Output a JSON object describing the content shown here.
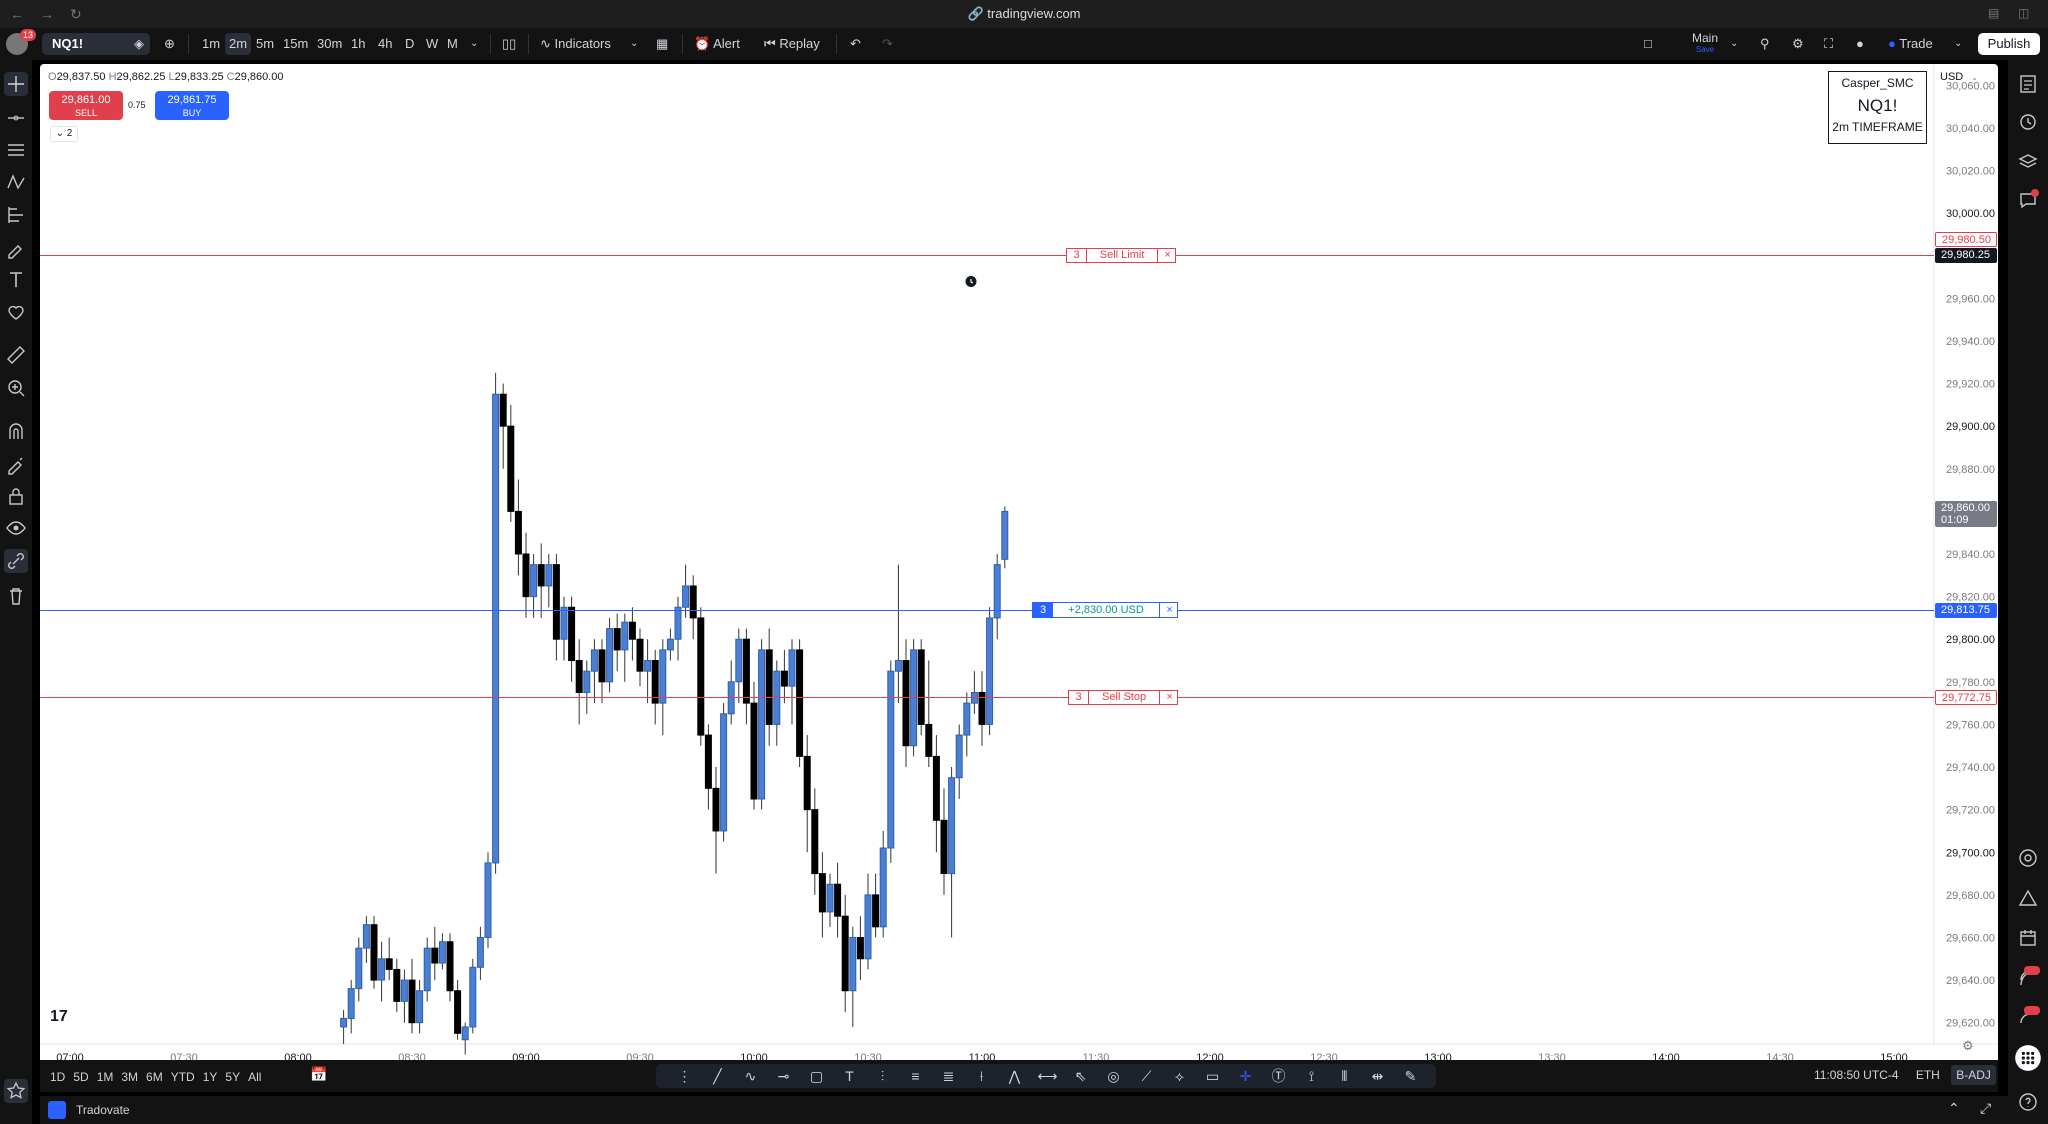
{
  "browser": {
    "url": "tradingview.com"
  },
  "header": {
    "notification_count": "13",
    "symbol": "NQ1!",
    "intervals": [
      "1m",
      "2m",
      "5m",
      "15m",
      "30m",
      "1h",
      "4h",
      "D",
      "W",
      "M"
    ],
    "active_interval": "2m",
    "indicators_label": "Indicators",
    "alert_label": "Alert",
    "replay_label": "Replay",
    "layout_name": "Main",
    "layout_sub": "Save",
    "trade_label": "Trade",
    "publish_label": "Publish"
  },
  "chart": {
    "ohlc": {
      "o_label": "O",
      "o": "29,837.50",
      "h_label": "H",
      "h": "29,862.25",
      "l_label": "L",
      "l": "29,833.25",
      "c_label": "C",
      "c": "29,860.00"
    },
    "sell_price": "29,861.00",
    "sell_label": "SELL",
    "buy_price": "29,861.75",
    "buy_label": "BUY",
    "spread": "0.75",
    "collapse_count": "2",
    "infobox": {
      "line1": "Casper_SMC",
      "line2": "NQ1!",
      "line3": "2m TIMEFRAME"
    },
    "currency": "USD",
    "y_ticks": [
      "30,060.00",
      "30,040.00",
      "30,020.00",
      "30,000.00",
      "29,980.00",
      "29,960.00",
      "29,940.00",
      "29,920.00",
      "29,900.00",
      "29,880.00",
      "29,860.00",
      "29,840.00",
      "29,820.00",
      "29,800.00",
      "29,780.00",
      "29,760.00",
      "29,740.00",
      "29,720.00",
      "29,700.00",
      "29,680.00",
      "29,660.00",
      "29,640.00",
      "29,620.00"
    ],
    "y_tick_values": [
      30060,
      30040,
      30020,
      30000,
      29980,
      29960,
      29940,
      29920,
      29900,
      29880,
      29860,
      29840,
      29820,
      29800,
      29780,
      29760,
      29740,
      29720,
      29700,
      29680,
      29660,
      29640,
      29620
    ],
    "x_ticks": [
      "07:00",
      "07:30",
      "08:00",
      "08:30",
      "09:00",
      "09:30",
      "10:00",
      "10:30",
      "11:00",
      "11:30",
      "12:00",
      "12:30",
      "13:00",
      "13:30",
      "14:00",
      "14:30",
      "15:00"
    ],
    "sell_limit": {
      "qty": "3",
      "label": "Sell Limit",
      "price": "29,980.50",
      "value": 29980.5
    },
    "crosshair_price": "29,980.25",
    "position": {
      "qty": "3",
      "pnl": "+2,830.00 USD",
      "price": "29,813.75",
      "value": 29813.75
    },
    "sell_stop": {
      "qty": "3",
      "label": "Sell Stop",
      "price": "29,772.75",
      "value": 29772.75
    },
    "last_price": "29,860.00",
    "countdown": "01:09",
    "close_glyph": "×"
  },
  "chart_data": {
    "type": "candlestick",
    "title": "NQ1!",
    "interval": "2m",
    "x_range": [
      "07:00",
      "15:00"
    ],
    "ylim": [
      29610,
      30070
    ],
    "candles": [
      [
        29618,
        29626,
        29610,
        29622
      ],
      [
        29622,
        29640,
        29615,
        29636
      ],
      [
        29636,
        29660,
        29630,
        29655
      ],
      [
        29655,
        29670,
        29648,
        29666
      ],
      [
        29666,
        29670,
        29636,
        29640
      ],
      [
        29640,
        29658,
        29630,
        29650
      ],
      [
        29650,
        29660,
        29640,
        29645
      ],
      [
        29645,
        29650,
        29625,
        29630
      ],
      [
        29630,
        29645,
        29620,
        29640
      ],
      [
        29640,
        29650,
        29615,
        29620
      ],
      [
        29620,
        29640,
        29615,
        29635
      ],
      [
        29635,
        29660,
        29630,
        29655
      ],
      [
        29655,
        29665,
        29640,
        29648
      ],
      [
        29648,
        29662,
        29645,
        29658
      ],
      [
        29658,
        29662,
        29630,
        29635
      ],
      [
        29635,
        29640,
        29612,
        29615
      ],
      [
        29612,
        29620,
        29605,
        29618
      ],
      [
        29618,
        29650,
        29615,
        29646
      ],
      [
        29646,
        29665,
        29640,
        29660
      ],
      [
        29660,
        29700,
        29655,
        29695
      ],
      [
        29695,
        29925,
        29690,
        29915
      ],
      [
        29915,
        29920,
        29880,
        29900
      ],
      [
        29900,
        29910,
        29855,
        29860
      ],
      [
        29860,
        29875,
        29830,
        29840
      ],
      [
        29840,
        29850,
        29810,
        29820
      ],
      [
        29820,
        29840,
        29810,
        29835
      ],
      [
        29835,
        29845,
        29810,
        29825
      ],
      [
        29825,
        29840,
        29815,
        29835
      ],
      [
        29835,
        29840,
        29790,
        29800
      ],
      [
        29800,
        29820,
        29790,
        29815
      ],
      [
        29815,
        29820,
        29780,
        29790
      ],
      [
        29790,
        29800,
        29760,
        29775
      ],
      [
        29775,
        29790,
        29765,
        29785
      ],
      [
        29785,
        29800,
        29770,
        29795
      ],
      [
        29795,
        29800,
        29770,
        29780
      ],
      [
        29780,
        29810,
        29775,
        29805
      ],
      [
        29805,
        29812,
        29785,
        29795
      ],
      [
        29795,
        29812,
        29780,
        29808
      ],
      [
        29808,
        29815,
        29790,
        29800
      ],
      [
        29800,
        29805,
        29778,
        29785
      ],
      [
        29785,
        29800,
        29770,
        29790
      ],
      [
        29790,
        29795,
        29760,
        29770
      ],
      [
        29770,
        29800,
        29755,
        29795
      ],
      [
        29795,
        29805,
        29790,
        29800
      ],
      [
        29800,
        29820,
        29790,
        29815
      ],
      [
        29815,
        29835,
        29810,
        29825
      ],
      [
        29825,
        29830,
        29800,
        29810
      ],
      [
        29810,
        29815,
        29750,
        29755
      ],
      [
        29755,
        29760,
        29720,
        29730
      ],
      [
        29730,
        29740,
        29690,
        29710
      ],
      [
        29710,
        29770,
        29705,
        29765
      ],
      [
        29765,
        29790,
        29760,
        29780
      ],
      [
        29780,
        29805,
        29770,
        29800
      ],
      [
        29800,
        29805,
        29760,
        29770
      ],
      [
        29770,
        29780,
        29720,
        29725
      ],
      [
        29725,
        29800,
        29720,
        29795
      ],
      [
        29795,
        29805,
        29750,
        29760
      ],
      [
        29760,
        29790,
        29750,
        29785
      ],
      [
        29785,
        29795,
        29770,
        29778
      ],
      [
        29778,
        29800,
        29760,
        29795
      ],
      [
        29795,
        29800,
        29740,
        29745
      ],
      [
        29745,
        29755,
        29700,
        29720
      ],
      [
        29720,
        29730,
        29680,
        29690
      ],
      [
        29690,
        29700,
        29660,
        29672
      ],
      [
        29672,
        29690,
        29665,
        29685
      ],
      [
        29685,
        29695,
        29660,
        29670
      ],
      [
        29670,
        29680,
        29625,
        29635
      ],
      [
        29635,
        29665,
        29618,
        29660
      ],
      [
        29660,
        29670,
        29640,
        29650
      ],
      [
        29650,
        29690,
        29645,
        29680
      ],
      [
        29680,
        29690,
        29660,
        29665
      ],
      [
        29665,
        29710,
        29660,
        29702
      ],
      [
        29702,
        29790,
        29695,
        29785
      ],
      [
        29785,
        29835,
        29770,
        29790
      ],
      [
        29790,
        29800,
        29740,
        29750
      ],
      [
        29750,
        29800,
        29745,
        29795
      ],
      [
        29795,
        29800,
        29755,
        29760
      ],
      [
        29760,
        29790,
        29740,
        29745
      ],
      [
        29745,
        29755,
        29700,
        29715
      ],
      [
        29715,
        29730,
        29680,
        29690
      ],
      [
        29690,
        29740,
        29660,
        29735
      ],
      [
        29735,
        29760,
        29725,
        29755
      ],
      [
        29755,
        29775,
        29745,
        29770
      ],
      [
        29770,
        29785,
        29765,
        29775
      ],
      [
        29775,
        29785,
        29750,
        29760
      ],
      [
        29760,
        29815,
        29755,
        29810
      ],
      [
        29810,
        29840,
        29800,
        29835
      ],
      [
        29837.5,
        29862.25,
        29833.25,
        29860
      ]
    ]
  }
}
